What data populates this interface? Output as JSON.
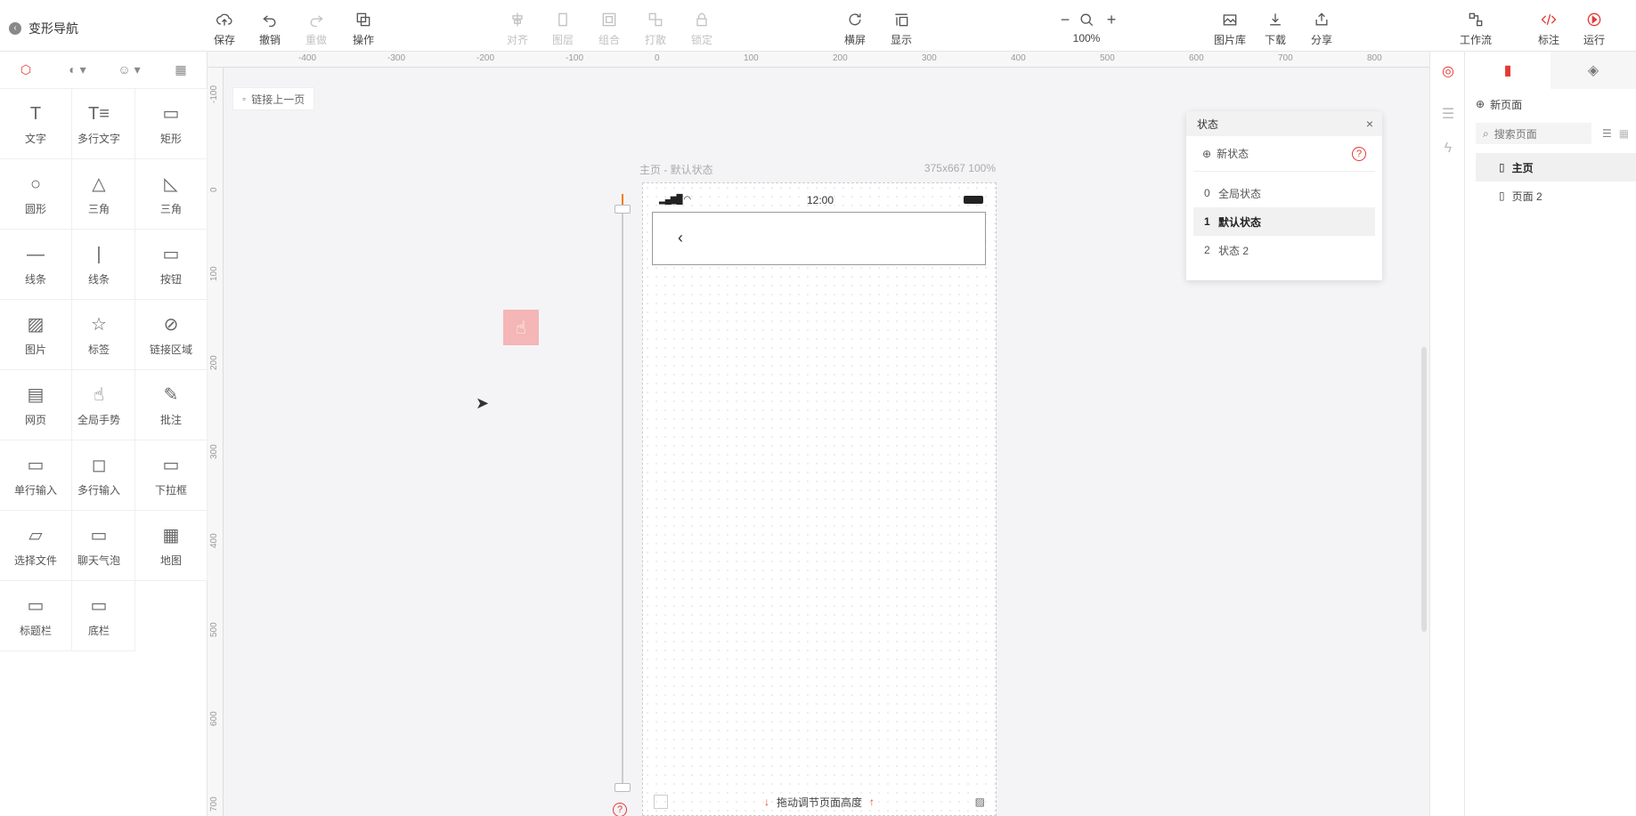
{
  "header": {
    "back_label": "变形导航",
    "groups": [
      {
        "label": "保存",
        "icon": "cloud-upload-icon",
        "disabled": false
      },
      {
        "label": "撤销",
        "icon": "undo-icon",
        "disabled": false
      },
      {
        "label": "重做",
        "icon": "redo-icon",
        "disabled": true
      },
      {
        "label": "操作",
        "icon": "operation-icon",
        "disabled": false
      },
      {
        "label": "对齐",
        "icon": "align-icon",
        "disabled": true
      },
      {
        "label": "图层",
        "icon": "layer-icon",
        "disabled": true
      },
      {
        "label": "组合",
        "icon": "group-icon",
        "disabled": true
      },
      {
        "label": "打散",
        "icon": "ungroup-icon",
        "disabled": true
      },
      {
        "label": "锁定",
        "icon": "lock-icon",
        "disabled": true
      },
      {
        "label": "横屏",
        "icon": "rotate-icon",
        "disabled": false
      },
      {
        "label": "显示",
        "icon": "display-icon",
        "disabled": false
      },
      {
        "label": "100%",
        "icon": "zoom-icon",
        "disabled": false
      },
      {
        "label": "图片库",
        "icon": "image-library-icon",
        "disabled": false
      },
      {
        "label": "下载",
        "icon": "download-icon",
        "disabled": false
      },
      {
        "label": "分享",
        "icon": "share-icon",
        "disabled": false
      },
      {
        "label": "工作流",
        "icon": "workflow-icon",
        "disabled": false
      },
      {
        "label": "标注",
        "icon": "code-icon",
        "disabled": false
      },
      {
        "label": "运行",
        "icon": "play-icon",
        "disabled": false
      }
    ]
  },
  "components": [
    {
      "label": "文字",
      "glyph": "T"
    },
    {
      "label": "多行文字",
      "glyph": "T≡"
    },
    {
      "label": "矩形",
      "glyph": "▭"
    },
    {
      "label": "圆形",
      "glyph": "○"
    },
    {
      "label": "三角",
      "glyph": "△"
    },
    {
      "label": "三角",
      "glyph": "◺"
    },
    {
      "label": "线条",
      "glyph": "—"
    },
    {
      "label": "线条",
      "glyph": "|"
    },
    {
      "label": "按钮",
      "glyph": "▭"
    },
    {
      "label": "图片",
      "glyph": "▨"
    },
    {
      "label": "标签",
      "glyph": "☆"
    },
    {
      "label": "链接区域",
      "glyph": "⊘"
    },
    {
      "label": "网页",
      "glyph": "▤"
    },
    {
      "label": "全局手势",
      "glyph": "☝"
    },
    {
      "label": "批注",
      "glyph": "✎"
    },
    {
      "label": "单行输入",
      "glyph": "▭"
    },
    {
      "label": "多行输入",
      "glyph": "◻"
    },
    {
      "label": "下拉框",
      "glyph": "▭"
    },
    {
      "label": "选择文件",
      "glyph": "▱"
    },
    {
      "label": "聊天气泡",
      "glyph": "▭"
    },
    {
      "label": "地图",
      "glyph": "▦"
    },
    {
      "label": "标题栏",
      "glyph": "▭"
    },
    {
      "label": "底栏",
      "glyph": "▭"
    }
  ],
  "ruler": {
    "top": [
      "-400",
      "-300",
      "-200",
      "-100",
      "0",
      "100",
      "200",
      "300",
      "400",
      "500",
      "600",
      "700",
      "800"
    ],
    "left": [
      "-100",
      "0",
      "100",
      "200",
      "300",
      "400",
      "500",
      "600",
      "700"
    ]
  },
  "link_prev_label": "链接上一页",
  "artboard": {
    "caption_left": "主页 - 默认状态",
    "caption_right": "375x667 100%",
    "time": "12:00",
    "back_glyph": "‹",
    "bottom_hint": "拖动调节页面高度"
  },
  "states_panel": {
    "title": "状态",
    "new_label": "新状态",
    "items": [
      {
        "index": "0",
        "label": "全局状态",
        "selected": false
      },
      {
        "index": "1",
        "label": "默认状态",
        "selected": true
      },
      {
        "index": "2",
        "label": "状态 2",
        "selected": false
      }
    ]
  },
  "pages_panel": {
    "new_label": "新页面",
    "search_placeholder": "搜索页面",
    "pages": [
      {
        "label": "主页",
        "selected": true
      },
      {
        "label": "页面 2",
        "selected": false
      }
    ]
  }
}
